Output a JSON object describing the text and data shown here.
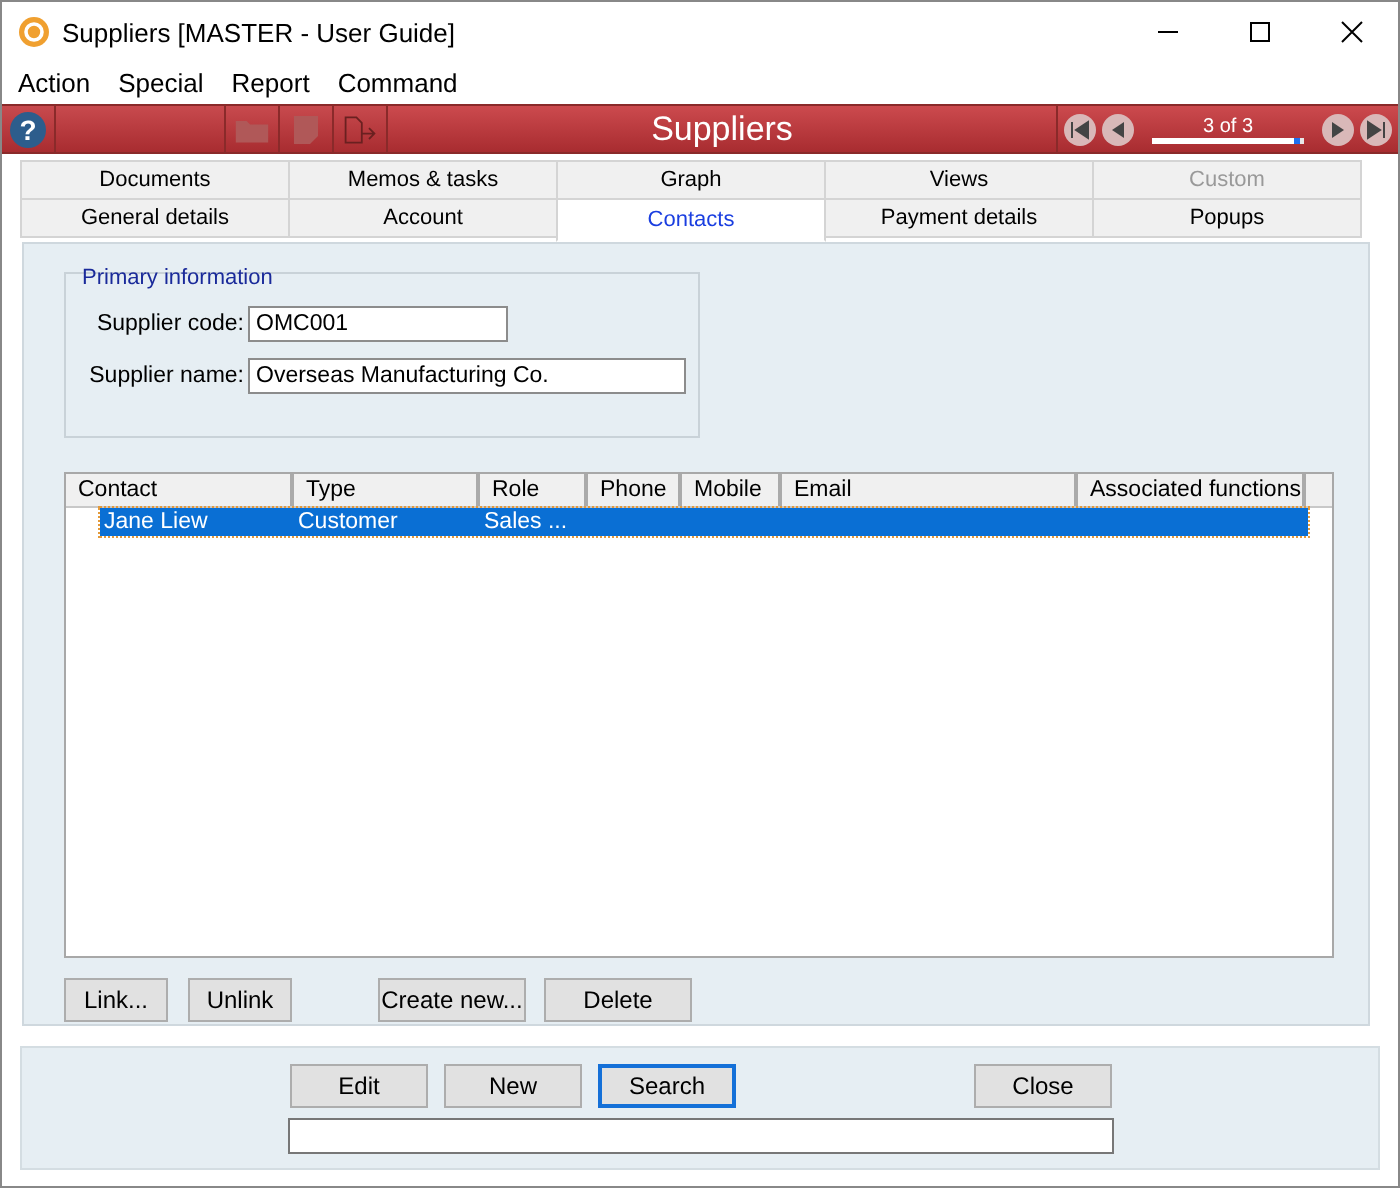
{
  "window": {
    "title": "Suppliers [MASTER - User Guide]"
  },
  "menu": [
    "Action",
    "Special",
    "Report",
    "Command"
  ],
  "toolbar": {
    "help": "?",
    "title": "Suppliers",
    "record": "3 of 3",
    "level": 0.97
  },
  "tab_rows": [
    [
      {
        "label": "Documents",
        "selected": false,
        "disabled": false
      },
      {
        "label": "Memos & tasks",
        "selected": false,
        "disabled": false
      },
      {
        "label": "Graph",
        "selected": false,
        "disabled": false
      },
      {
        "label": "Views",
        "selected": false,
        "disabled": false
      },
      {
        "label": "Custom",
        "selected": false,
        "disabled": true
      }
    ],
    [
      {
        "label": "General details",
        "selected": false,
        "disabled": false
      },
      {
        "label": "Account",
        "selected": false,
        "disabled": false
      },
      {
        "label": "Contacts",
        "selected": true,
        "disabled": false
      },
      {
        "label": "Payment details",
        "selected": false,
        "disabled": false
      },
      {
        "label": "Popups",
        "selected": false,
        "disabled": false
      }
    ]
  ],
  "primary": {
    "title": "Primary information",
    "fields": [
      {
        "label": "Supplier code:",
        "value": "OMC001"
      },
      {
        "label": "Supplier name:",
        "value": "Overseas Manufacturing Co."
      }
    ]
  },
  "table": {
    "columns": [
      "Contact",
      "Type",
      "Role",
      "Phone",
      "Mobile",
      "Email",
      "Associated functions"
    ],
    "rows": [
      {
        "cells": [
          "Jane Liew",
          "Customer",
          "Sales ...",
          "",
          "",
          "",
          ""
        ],
        "selected": true
      }
    ]
  },
  "list_buttons": [
    "Link...",
    "Unlink",
    "Create new...",
    "Delete"
  ],
  "footer_buttons": [
    {
      "label": "Edit",
      "focused": false
    },
    {
      "label": "New",
      "focused": false
    },
    {
      "label": "Search",
      "focused": true
    },
    {
      "label": "Close",
      "focused": false
    }
  ]
}
